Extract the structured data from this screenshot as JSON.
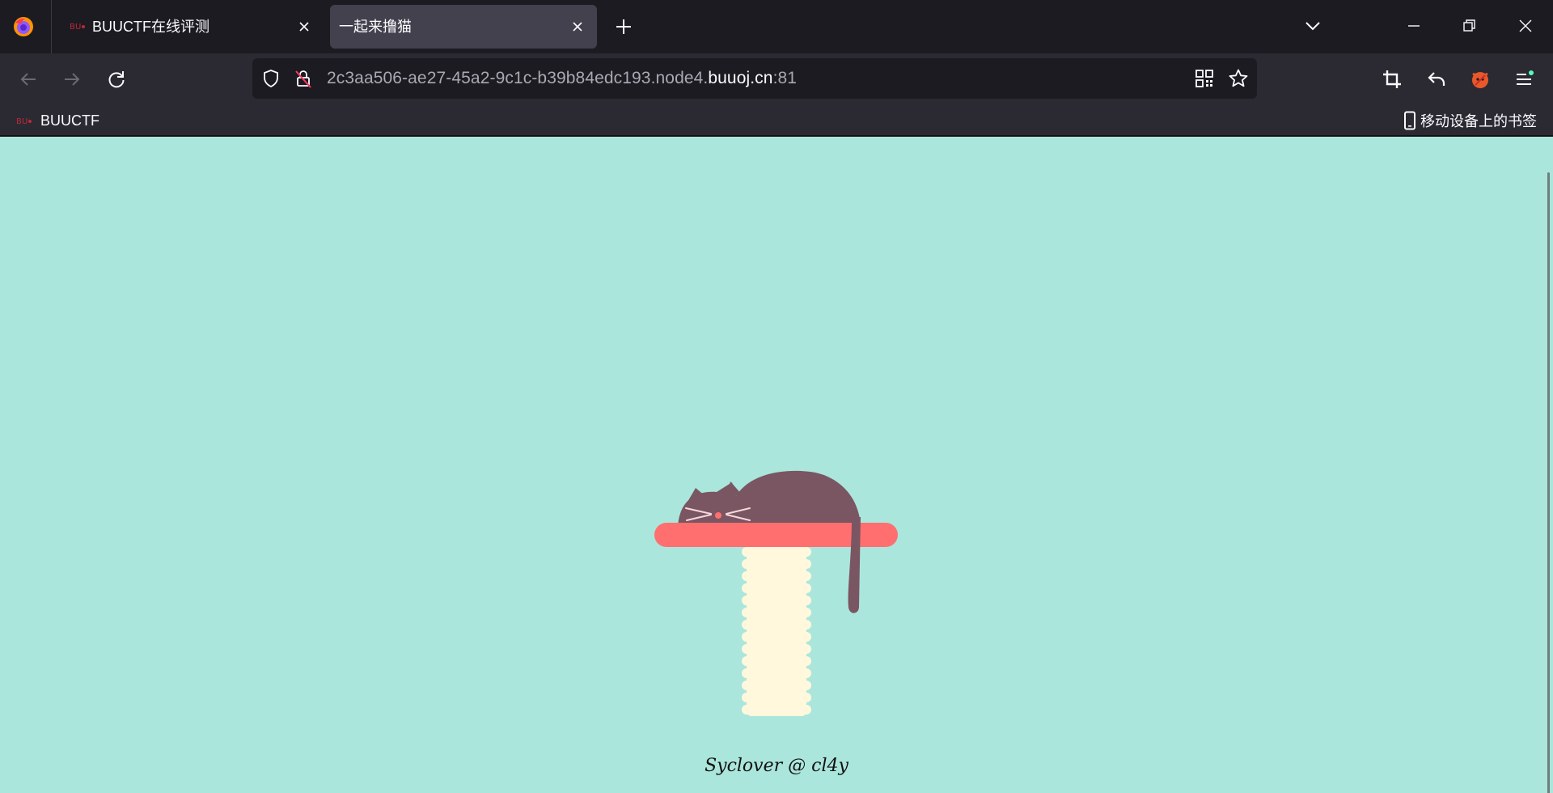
{
  "browser": {
    "tabs": [
      {
        "title": "BUUCTF在线评测",
        "active": false
      },
      {
        "title": "一起来撸猫",
        "active": true
      }
    ],
    "address": {
      "prefix": "2c3aa506-ae27-45a2-9c1c-b39b84edc193.node4.",
      "domain": "buuoj.cn",
      "port": ":81"
    },
    "bookmarks": [
      {
        "label": "BUUCTF"
      }
    ],
    "mobile_bookmarks_label": "移动设备上的书签"
  },
  "page": {
    "signature": "Syclover @ cl4y",
    "colors": {
      "background": "#abe6dc",
      "cat": "#7a5662",
      "shelf": "#ff6f6f",
      "post": "#fff8dc"
    }
  }
}
